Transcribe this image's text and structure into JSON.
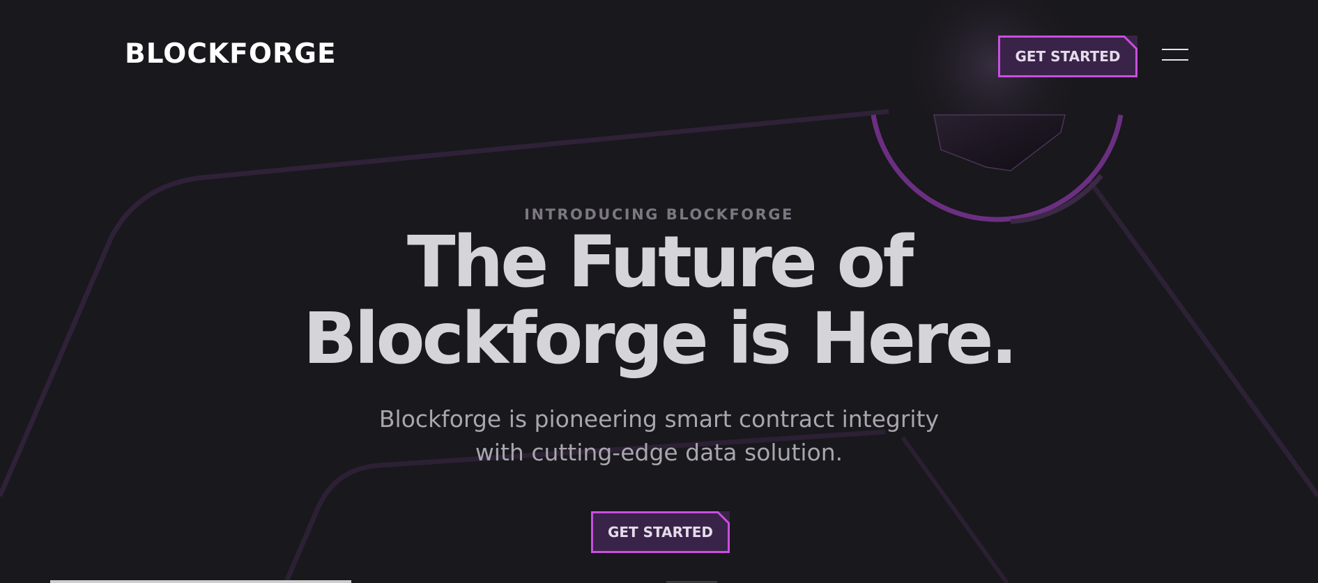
{
  "header": {
    "logo": "BLOCKFORGE",
    "cta_label": "GET STARTED",
    "menu_icon": "hamburger-menu-icon"
  },
  "hero": {
    "eyebrow": "INTRODUCING BLOCKFORGE",
    "headline_line1": "The Future of",
    "headline_line2": "Blockforge is Here.",
    "subhead_line1": "Blockforge is pioneering smart contract integrity",
    "subhead_line2": "with cutting-edge data solution.",
    "cta_label": "GET STARTED"
  },
  "colors": {
    "background": "#19181c",
    "accent": "#c94fe0",
    "button_fill": "#3a2348",
    "headline": "#d5d4d9"
  }
}
